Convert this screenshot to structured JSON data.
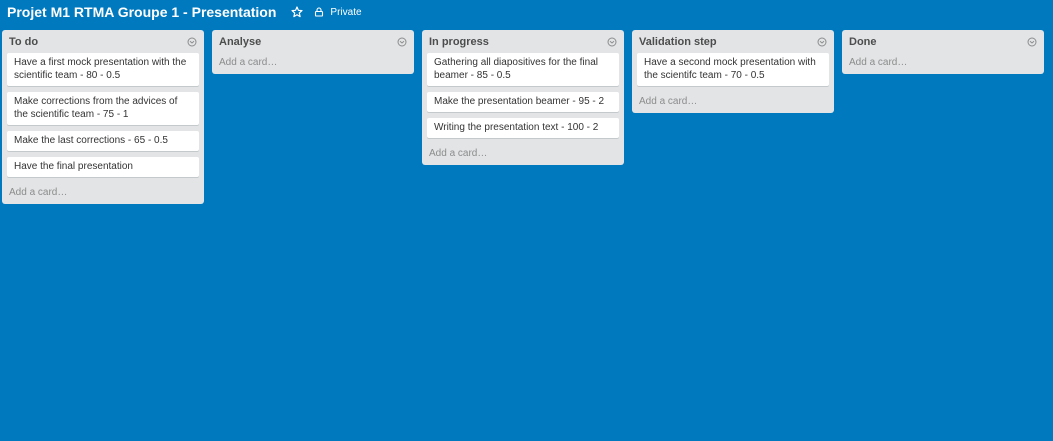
{
  "board": {
    "title": "Projet M1 RTMA Groupe 1 - Presentation",
    "visibility_label": "Private"
  },
  "colors": {
    "background": "#0079bf",
    "list_bg": "#e2e4e6",
    "card_bg": "#ffffff"
  },
  "lists": [
    {
      "title": "To do",
      "cards": [
        "Have a first mock presentation with the scientific team - 80 - 0.5",
        "Make corrections from the advices of the scientific team - 75 - 1",
        "Make the last corrections - 65 - 0.5",
        "Have the final presentation"
      ],
      "add_label": "Add a card…"
    },
    {
      "title": "Analyse",
      "cards": [],
      "add_label": "Add a card…"
    },
    {
      "title": "In progress",
      "cards": [
        "Gathering all diapositives for the final beamer - 85 - 0.5",
        "Make the presentation beamer - 95 - 2",
        "Writing the presentation text - 100 - 2"
      ],
      "add_label": "Add a card…"
    },
    {
      "title": "Validation step",
      "cards": [
        "Have a second mock presentation with the scientifc team - 70 - 0.5"
      ],
      "add_label": "Add a card…"
    },
    {
      "title": "Done",
      "cards": [],
      "add_label": "Add a card…"
    }
  ]
}
